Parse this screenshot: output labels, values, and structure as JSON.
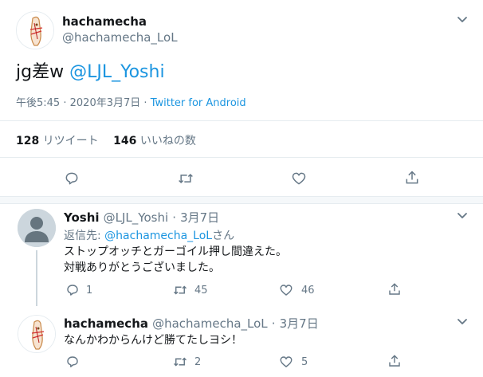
{
  "main_tweet": {
    "display_name": "hachamecha",
    "handle": "@hachamecha_LoL",
    "text_plain": "jg差w ",
    "text_mention": "@LJL_Yoshi",
    "time": "午後5:45",
    "sep": "·",
    "date": "2020年3月7日",
    "source": "Twitter for Android",
    "retweet_count": "128",
    "retweet_label": "リツイート",
    "like_count": "146",
    "like_label": "いいねの数"
  },
  "replies": [
    {
      "display_name": "Yoshi",
      "handle": "@LJL_Yoshi",
      "sep": "·",
      "date": "3月7日",
      "reply_to_prefix": "返信先: ",
      "reply_to_handle": "@hachamecha_LoL",
      "reply_to_suffix": "さん",
      "text_line1": "ストップオッチとガーゴイル押し間違えた。",
      "text_line2": "対戦ありがとうございました。",
      "reply_count": "1",
      "retweet_count": "45",
      "like_count": "46"
    },
    {
      "display_name": "hachamecha",
      "handle": "@hachamecha_LoL",
      "sep": "·",
      "date": "3月7日",
      "text_line1": "なんかわからんけど勝てたしヨシ！",
      "reply_count": "",
      "retweet_count": "2",
      "like_count": "5"
    }
  ],
  "colors": {
    "accent": "#1b95e0",
    "text_secondary": "#657786",
    "icon_gray": "#657786"
  },
  "icons": [
    "chevron-down-icon",
    "reply-icon",
    "retweet-icon",
    "like-icon",
    "share-icon",
    "default-avatar-icon"
  ]
}
